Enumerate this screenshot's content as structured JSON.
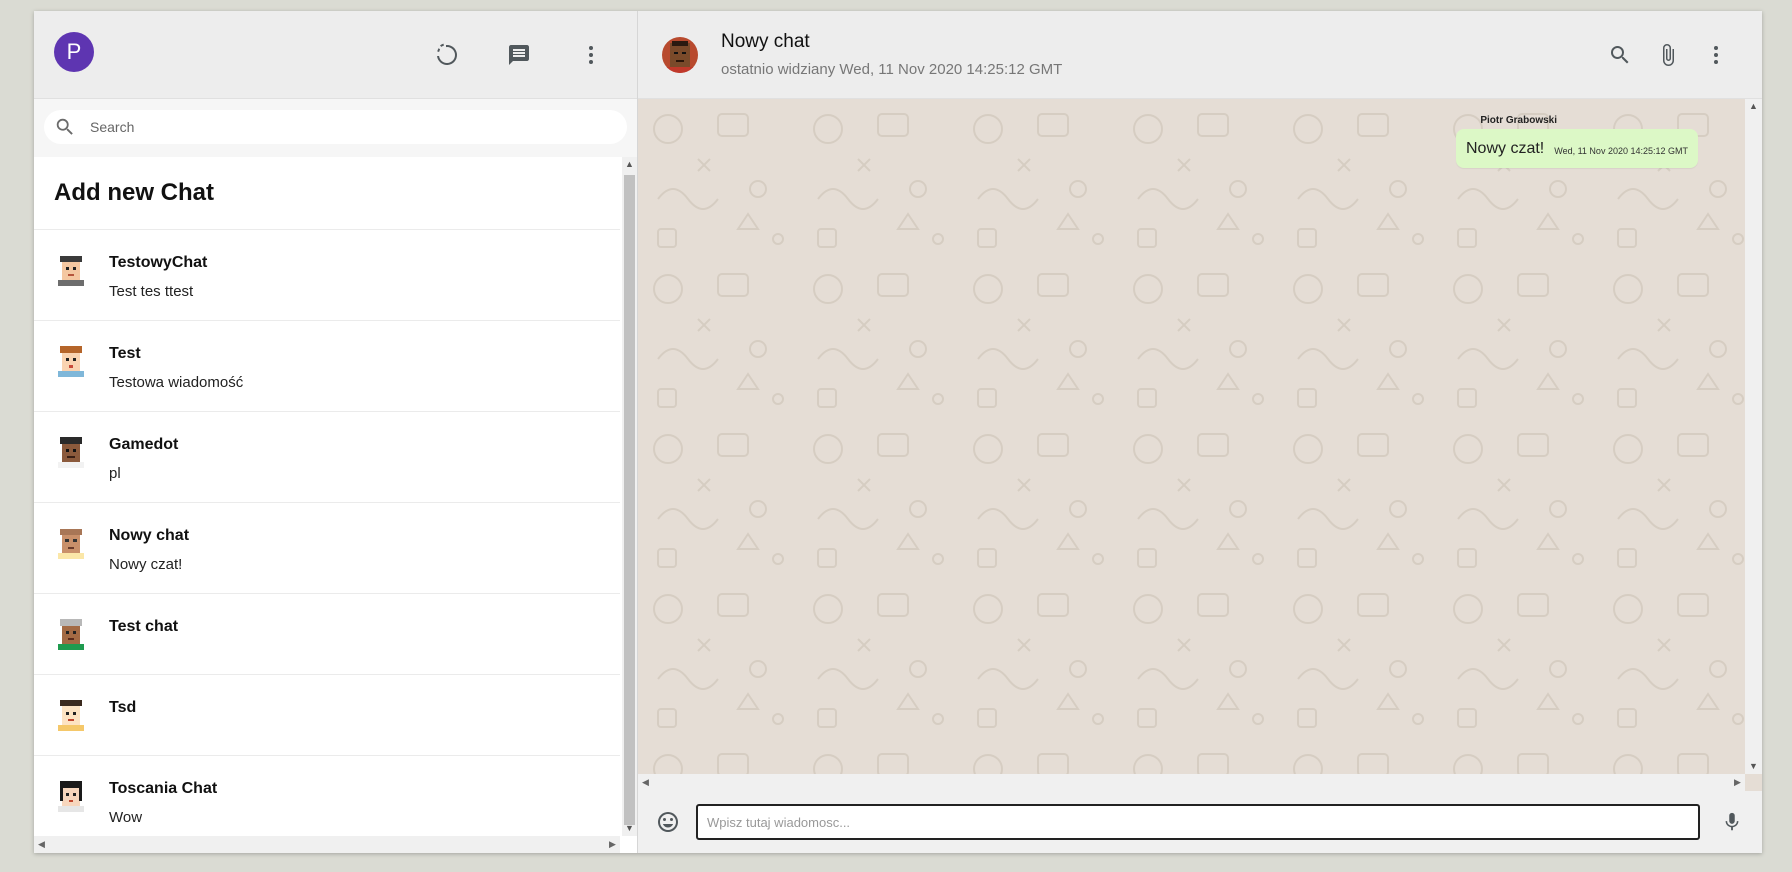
{
  "sidebar": {
    "avatar_letter": "P",
    "search_placeholder": "Search",
    "add_chat_label": "Add new Chat",
    "chats": [
      {
        "name": "TestowyChat",
        "last": "Test tes ttest"
      },
      {
        "name": "Test",
        "last": "Testowa wiadomość"
      },
      {
        "name": "Gamedot",
        "last": "pl"
      },
      {
        "name": "Nowy chat",
        "last": "Nowy czat!"
      },
      {
        "name": "Test chat",
        "last": ""
      },
      {
        "name": "Tsd",
        "last": ""
      },
      {
        "name": "Toscania Chat",
        "last": "Wow"
      }
    ]
  },
  "header": {
    "title": "Nowy chat",
    "subtitle": "ostatnio widziany Wed, 11 Nov 2020 14:25:12 GMT"
  },
  "messages": [
    {
      "author": "Piotr Grabowski",
      "text": "Nowy czat!",
      "time": "Wed, 11 Nov 2020 14:25:12 GMT"
    }
  ],
  "composer": {
    "placeholder": "Wpisz tutaj wiadomosc..."
  },
  "colors": {
    "avatar_bg": "#5e35b1",
    "chat_bg": "#e5ddd5",
    "bubble_bg": "#dcf8c6",
    "header_bg": "#ededed"
  },
  "icons": [
    "status-icon",
    "new-chat-icon",
    "menu-icon",
    "search-icon",
    "attach-icon",
    "emoji-icon",
    "mic-icon"
  ]
}
